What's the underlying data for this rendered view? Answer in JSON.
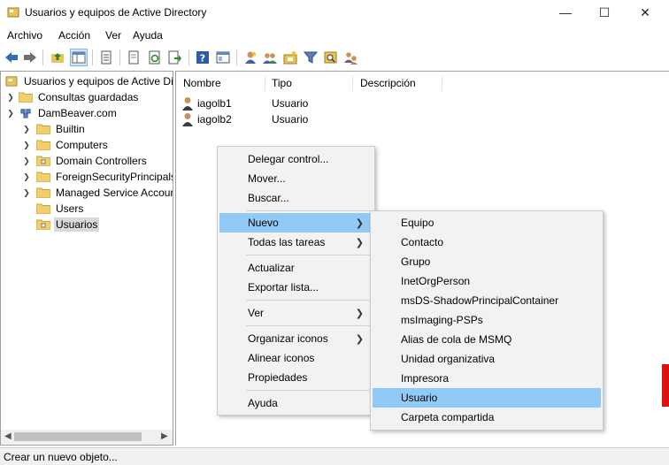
{
  "window": {
    "title": "Usuarios y equipos de Active Directory",
    "controls": {
      "minimize": "—",
      "maximize": "☐",
      "close": "✕"
    }
  },
  "menubar": [
    "Archivo",
    "Acción",
    "Ver",
    "Ayuda"
  ],
  "toolbar_icons": [
    "back-icon",
    "forward-icon",
    "up-folder-icon",
    "show-tree-icon",
    "properties-icon",
    "copy-icon",
    "refresh-icon",
    "export-icon",
    "help-icon",
    "mmc-view-icon",
    "new-user-icon",
    "new-group-icon",
    "new-ou-icon",
    "filter-icon",
    "find-icon",
    "delegate-icon"
  ],
  "tree": {
    "root": "Usuarios y equipos de Active Directory",
    "saved_queries": "Consultas guardadas",
    "domain": "DamBeaver.com",
    "children": [
      "Builtin",
      "Computers",
      "Domain Controllers",
      "ForeignSecurityPrincipals",
      "Managed Service Accounts",
      "Users",
      "Usuarios"
    ],
    "selected": "Usuarios"
  },
  "list": {
    "columns": [
      "Nombre",
      "Tipo",
      "Descripción"
    ],
    "rows": [
      {
        "name": "iagolb1",
        "type": "Usuario",
        "desc": ""
      },
      {
        "name": "iagolb2",
        "type": "Usuario",
        "desc": ""
      }
    ]
  },
  "context_menu": {
    "items": [
      "Delegar control...",
      "Mover...",
      "Buscar...",
      "Nuevo",
      "Todas las tareas",
      "Actualizar",
      "Exportar lista...",
      "Ver",
      "Organizar iconos",
      "Alinear iconos",
      "Propiedades",
      "Ayuda"
    ],
    "highlighted": "Nuevo"
  },
  "submenu": {
    "items": [
      "Equipo",
      "Contacto",
      "Grupo",
      "InetOrgPerson",
      "msDS-ShadowPrincipalContainer",
      "msImaging-PSPs",
      "Alias de cola de MSMQ",
      "Unidad organizativa",
      "Impresora",
      "Usuario",
      "Carpeta compartida"
    ],
    "highlighted": "Usuario"
  },
  "status": "Crear un nuevo objeto..."
}
